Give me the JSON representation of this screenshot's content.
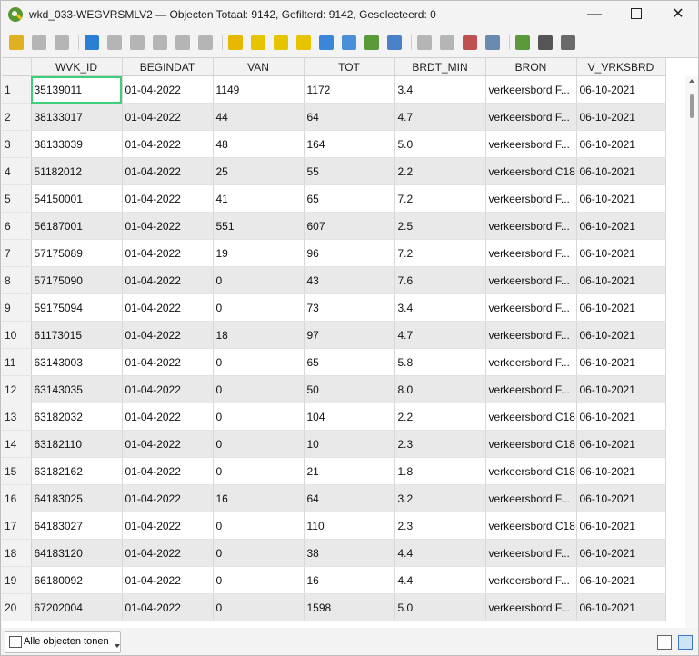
{
  "window": {
    "title": "wkd_033-WEGVRSMLV2 — Objecten Totaal: 9142, Gefilterd: 9142, Geselecteerd: 0",
    "minimize_glyph": "—",
    "close_glyph": "✕"
  },
  "toolbar": {
    "icons": [
      {
        "name": "toggle-editing-icon",
        "color": "#e0b020"
      },
      {
        "name": "multi-edit-icon",
        "color": "#b5b5b5"
      },
      {
        "name": "save-edits-icon",
        "color": "#b5b5b5"
      },
      {
        "name": "reload-table-icon",
        "color": "#2a7fd4"
      },
      {
        "name": "add-feature-icon",
        "color": "#b5b5b5"
      },
      {
        "name": "delete-selected-icon",
        "color": "#b5b5b5"
      },
      {
        "name": "cut-icon",
        "color": "#b5b5b5"
      },
      {
        "name": "copy-icon",
        "color": "#b5b5b5"
      },
      {
        "name": "paste-icon",
        "color": "#b5b5b5"
      },
      {
        "name": "select-by-expression-icon",
        "color": "#e6b800"
      },
      {
        "name": "select-all-icon",
        "color": "#e6c400"
      },
      {
        "name": "invert-selection-icon",
        "color": "#e6c400"
      },
      {
        "name": "deselect-all-icon",
        "color": "#e6c400"
      },
      {
        "name": "filter-select-icon",
        "color": "#3b86d8"
      },
      {
        "name": "move-selection-to-top-icon",
        "color": "#4a90d9"
      },
      {
        "name": "pan-to-selected-icon",
        "color": "#5a9a3a"
      },
      {
        "name": "zoom-to-selected-icon",
        "color": "#4a80c8"
      },
      {
        "name": "new-field-icon",
        "color": "#b5b5b5"
      },
      {
        "name": "delete-field-icon",
        "color": "#b5b5b5"
      },
      {
        "name": "field-calculator-icon",
        "color": "#c05050"
      },
      {
        "name": "conditional-formatting-icon",
        "color": "#6a8ab0"
      },
      {
        "name": "actions-icon",
        "color": "#5a9a3a"
      },
      {
        "name": "zoom-map-icon",
        "color": "#555555"
      },
      {
        "name": "dock-icon",
        "color": "#6a6a6a"
      }
    ]
  },
  "table": {
    "columns": [
      "WVK_ID",
      "BEGINDAT",
      "VAN",
      "TOT",
      "BRDT_MIN",
      "BRON",
      "V_VRKSBRD"
    ],
    "rows": [
      [
        "1",
        "35139011",
        "01-04-2022",
        "1149",
        "1172",
        "3.4",
        "verkeersbord F...",
        "06-10-2021"
      ],
      [
        "2",
        "38133017",
        "01-04-2022",
        "44",
        "64",
        "4.7",
        "verkeersbord F...",
        "06-10-2021"
      ],
      [
        "3",
        "38133039",
        "01-04-2022",
        "48",
        "164",
        "5.0",
        "verkeersbord F...",
        "06-10-2021"
      ],
      [
        "4",
        "51182012",
        "01-04-2022",
        "25",
        "55",
        "2.2",
        "verkeersbord C18",
        "06-10-2021"
      ],
      [
        "5",
        "54150001",
        "01-04-2022",
        "41",
        "65",
        "7.2",
        "verkeersbord F...",
        "06-10-2021"
      ],
      [
        "6",
        "56187001",
        "01-04-2022",
        "551",
        "607",
        "2.5",
        "verkeersbord F...",
        "06-10-2021"
      ],
      [
        "7",
        "57175089",
        "01-04-2022",
        "19",
        "96",
        "7.2",
        "verkeersbord F...",
        "06-10-2021"
      ],
      [
        "8",
        "57175090",
        "01-04-2022",
        "0",
        "43",
        "7.6",
        "verkeersbord F...",
        "06-10-2021"
      ],
      [
        "9",
        "59175094",
        "01-04-2022",
        "0",
        "73",
        "3.4",
        "verkeersbord F...",
        "06-10-2021"
      ],
      [
        "10",
        "61173015",
        "01-04-2022",
        "18",
        "97",
        "4.7",
        "verkeersbord F...",
        "06-10-2021"
      ],
      [
        "11",
        "63143003",
        "01-04-2022",
        "0",
        "65",
        "5.8",
        "verkeersbord F...",
        "06-10-2021"
      ],
      [
        "12",
        "63143035",
        "01-04-2022",
        "0",
        "50",
        "8.0",
        "verkeersbord F...",
        "06-10-2021"
      ],
      [
        "13",
        "63182032",
        "01-04-2022",
        "0",
        "104",
        "2.2",
        "verkeersbord C18",
        "06-10-2021"
      ],
      [
        "14",
        "63182110",
        "01-04-2022",
        "0",
        "10",
        "2.3",
        "verkeersbord C18",
        "06-10-2021"
      ],
      [
        "15",
        "63182162",
        "01-04-2022",
        "0",
        "21",
        "1.8",
        "verkeersbord C18",
        "06-10-2021"
      ],
      [
        "16",
        "64183025",
        "01-04-2022",
        "16",
        "64",
        "3.2",
        "verkeersbord F...",
        "06-10-2021"
      ],
      [
        "17",
        "64183027",
        "01-04-2022",
        "0",
        "110",
        "2.3",
        "verkeersbord C18",
        "06-10-2021"
      ],
      [
        "18",
        "64183120",
        "01-04-2022",
        "0",
        "38",
        "4.4",
        "verkeersbord F...",
        "06-10-2021"
      ],
      [
        "19",
        "66180092",
        "01-04-2022",
        "0",
        "16",
        "4.4",
        "verkeersbord F...",
        "06-10-2021"
      ],
      [
        "20",
        "67202004",
        "01-04-2022",
        "0",
        "1598",
        "5.0",
        "verkeersbord F...",
        "06-10-2021"
      ]
    ]
  },
  "bottombar": {
    "show_all_label": "Alle objecten tonen",
    "form_view_icon": "form-view-icon",
    "table_view_icon": "table-view-icon"
  },
  "colors": {
    "selection_outline": "#3fcf7a",
    "alt_row": "#e9e9e9"
  }
}
